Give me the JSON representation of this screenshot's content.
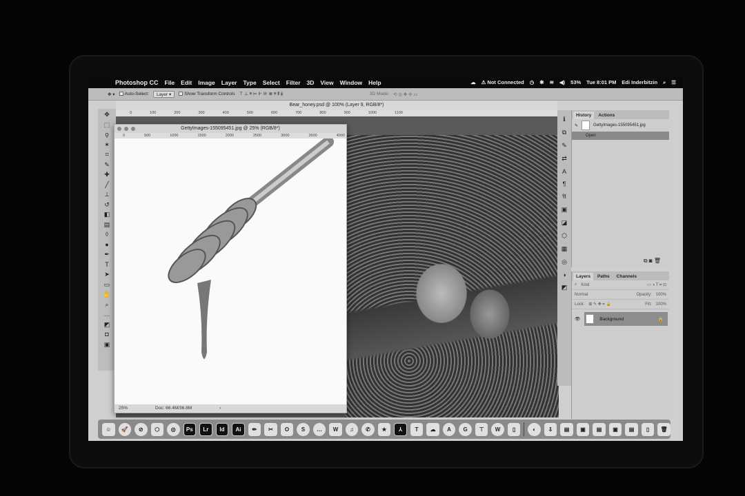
{
  "menubar": {
    "app": "Photoshop CC",
    "items": [
      "File",
      "Edit",
      "Image",
      "Layer",
      "Type",
      "Select",
      "Filter",
      "3D",
      "View",
      "Window",
      "Help"
    ],
    "status": "Not Connected",
    "battery": "53%",
    "clock": "Tue 8:01 PM",
    "user": "Edi Inderbitzin"
  },
  "options": {
    "auto_select": "Auto-Select:",
    "layer_select": "Layer",
    "show_transform": "Show Transform Controls",
    "mode_3d": "3D Mode:"
  },
  "document": {
    "tab_title": "Bear_honey.psd @ 100% (Layer 9, RGB/8*)",
    "ruler": [
      "0",
      "100",
      "200",
      "300",
      "400",
      "500",
      "600",
      "700",
      "800",
      "900",
      "1000",
      "1100"
    ]
  },
  "getty": {
    "title": "GettyImages-155095451.jpg @ 25% (RGB/8*)",
    "ruler": [
      "0",
      "500",
      "1000",
      "1500",
      "2000",
      "2500",
      "3000",
      "3500",
      "4000"
    ],
    "zoom": "25%",
    "doc_size": "Doc: 66.4M/36.8M"
  },
  "history": {
    "tabs": [
      "History",
      "Actions"
    ],
    "snapshot": "GettyImages-155095451.jpg",
    "step": "Open"
  },
  "layers": {
    "tabs": [
      "Layers",
      "Paths",
      "Channels"
    ],
    "kind": "Kind",
    "blend": "Normal",
    "opacity_label": "Opacity:",
    "opacity": "100%",
    "lock_label": "Lock:",
    "fill_label": "Fill:",
    "fill": "100%",
    "layer_name": "Background"
  },
  "dock": [
    "Ps",
    "Lr",
    "Id",
    "Ai"
  ]
}
